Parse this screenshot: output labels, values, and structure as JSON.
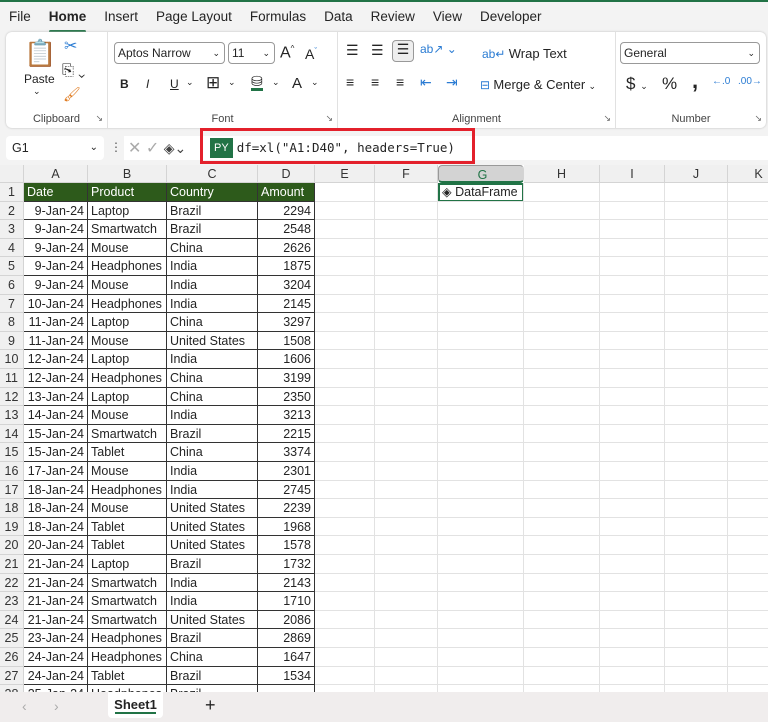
{
  "tabs": [
    "File",
    "Home",
    "Insert",
    "Page Layout",
    "Formulas",
    "Data",
    "Review",
    "View",
    "Developer"
  ],
  "active_tab": "Home",
  "ribbon": {
    "clipboard": {
      "paste": "Paste",
      "label": "Clipboard"
    },
    "font": {
      "name": "Aptos Narrow",
      "size": "11",
      "label": "Font",
      "bold": "B",
      "italic": "I",
      "underline": "U",
      "grow": "A",
      "shrink": "A",
      "color": "A"
    },
    "alignment": {
      "wrap": "Wrap Text",
      "merge": "Merge & Center",
      "label": "Alignment"
    },
    "number": {
      "format": "General",
      "currency": "$",
      "percent": "%",
      "comma": ",",
      "label": "Number"
    }
  },
  "formula_bar": {
    "name_box": "G1",
    "py_badge": "PY",
    "formula": "df=xl(\"A1:D40\", headers=True)"
  },
  "columns": [
    "A",
    "B",
    "C",
    "D",
    "E",
    "F",
    "G",
    "H",
    "I",
    "J",
    "K"
  ],
  "selected_column": "G",
  "table_headers": [
    "Date",
    "Product",
    "Country",
    "Amount"
  ],
  "rows": [
    [
      "9-Jan-24",
      "Laptop",
      "Brazil",
      "2294"
    ],
    [
      "9-Jan-24",
      "Smartwatch",
      "Brazil",
      "2548"
    ],
    [
      "9-Jan-24",
      "Mouse",
      "China",
      "2626"
    ],
    [
      "9-Jan-24",
      "Headphones",
      "India",
      "1875"
    ],
    [
      "9-Jan-24",
      "Mouse",
      "India",
      "3204"
    ],
    [
      "10-Jan-24",
      "Headphones",
      "India",
      "2145"
    ],
    [
      "11-Jan-24",
      "Laptop",
      "China",
      "3297"
    ],
    [
      "11-Jan-24",
      "Mouse",
      "United States",
      "1508"
    ],
    [
      "12-Jan-24",
      "Laptop",
      "India",
      "1606"
    ],
    [
      "12-Jan-24",
      "Headphones",
      "China",
      "3199"
    ],
    [
      "13-Jan-24",
      "Laptop",
      "China",
      "2350"
    ],
    [
      "14-Jan-24",
      "Mouse",
      "India",
      "3213"
    ],
    [
      "15-Jan-24",
      "Smartwatch",
      "Brazil",
      "2215"
    ],
    [
      "15-Jan-24",
      "Tablet",
      "China",
      "3374"
    ],
    [
      "17-Jan-24",
      "Mouse",
      "India",
      "2301"
    ],
    [
      "18-Jan-24",
      "Headphones",
      "India",
      "2745"
    ],
    [
      "18-Jan-24",
      "Mouse",
      "United States",
      "2239"
    ],
    [
      "18-Jan-24",
      "Tablet",
      "United States",
      "1968"
    ],
    [
      "20-Jan-24",
      "Tablet",
      "United States",
      "1578"
    ],
    [
      "21-Jan-24",
      "Laptop",
      "Brazil",
      "1732"
    ],
    [
      "21-Jan-24",
      "Smartwatch",
      "India",
      "2143"
    ],
    [
      "21-Jan-24",
      "Smartwatch",
      "India",
      "1710"
    ],
    [
      "21-Jan-24",
      "Smartwatch",
      "United States",
      "2086"
    ],
    [
      "23-Jan-24",
      "Headphones",
      "Brazil",
      "2869"
    ],
    [
      "24-Jan-24",
      "Headphones",
      "China",
      "1647"
    ],
    [
      "24-Jan-24",
      "Tablet",
      "Brazil",
      "1534"
    ],
    [
      "25-Jan-24",
      "Headphones",
      "Brazil",
      ""
    ]
  ],
  "g1_value": "DataFrame",
  "sheets": [
    "Sheet1"
  ],
  "colors": {
    "accent": "#217346",
    "header_fill": "#2d5a1b",
    "highlight": "#e3202b"
  }
}
